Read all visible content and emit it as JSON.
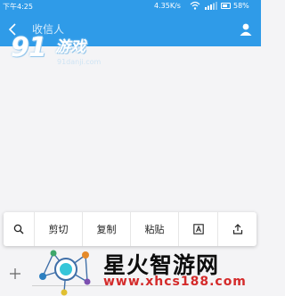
{
  "status_bar": {
    "time": "下午4:25",
    "network_speed": "4.35K/s",
    "battery": "58%"
  },
  "header": {
    "recipient_placeholder": "收信人",
    "back_icon": "back-arrow-icon",
    "contact_icon": "person-icon"
  },
  "selection_toolbar": {
    "search_icon": "search-icon",
    "cut": "剪切",
    "copy": "复制",
    "paste": "粘贴",
    "format_icon": "text-format-icon",
    "share_icon": "share-icon"
  },
  "compose": {
    "add_icon": "plus-icon"
  },
  "watermark_top": {
    "logo": "91",
    "text": "游戏",
    "url": "91danji.com"
  },
  "watermark_bottom": {
    "text": "星火智游网",
    "url": "www.xhcs188.com"
  },
  "colors": {
    "header": "#2f9be8",
    "background": "#f4f4f6",
    "watermark_url": "#d42b2b"
  }
}
